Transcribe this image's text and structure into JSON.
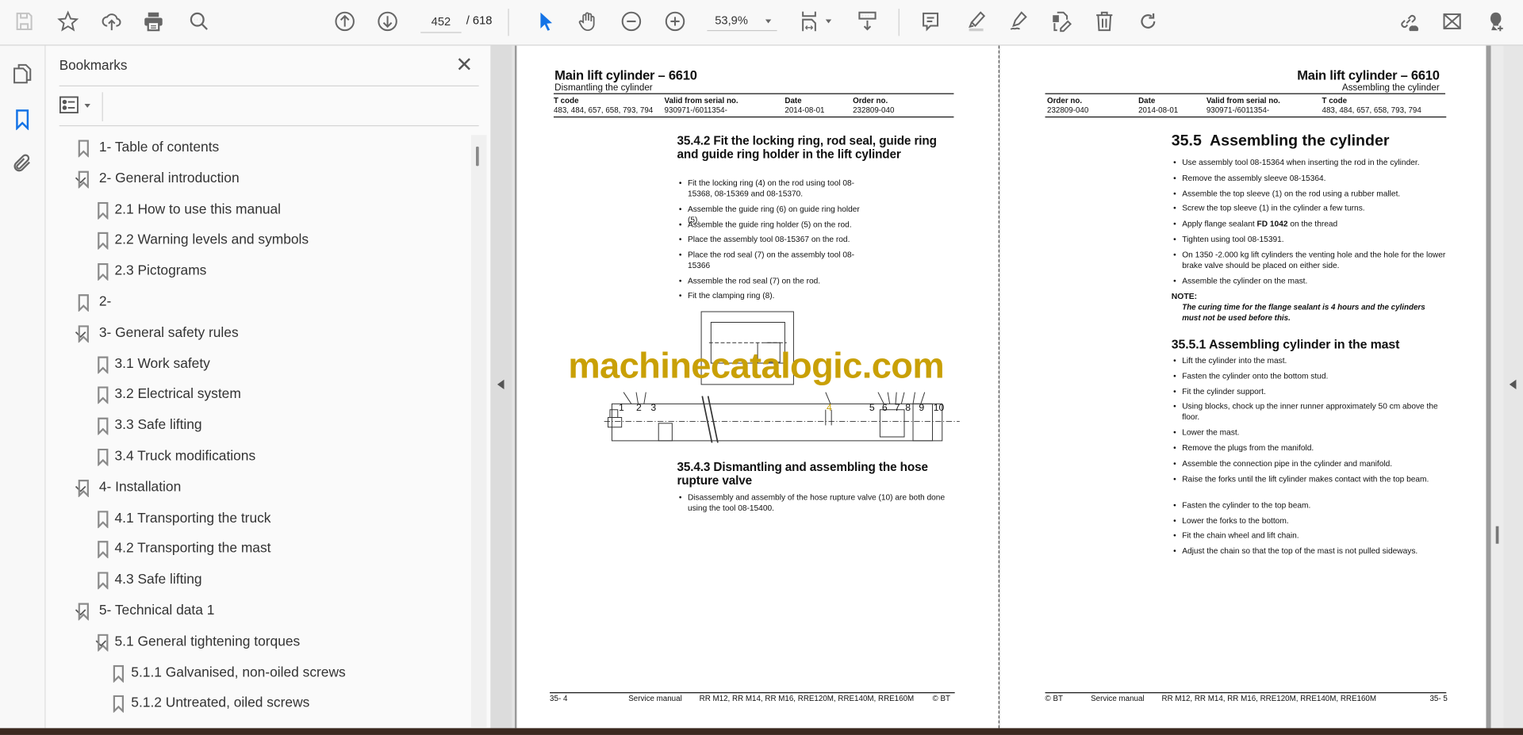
{
  "toolbar": {
    "page_current": "452",
    "page_total": "/ 618",
    "zoom": "53,9%"
  },
  "panel": {
    "title": "Bookmarks"
  },
  "bookmarks": [
    {
      "label": "1- Table of contents",
      "level": 0,
      "expandable": false
    },
    {
      "label": "2- General introduction",
      "level": 0,
      "expandable": true
    },
    {
      "label": "2.1 How to use this manual",
      "level": 1,
      "expandable": false
    },
    {
      "label": "2.2 Warning levels and symbols",
      "level": 1,
      "expandable": false
    },
    {
      "label": "2.3 Pictograms",
      "level": 1,
      "expandable": false
    },
    {
      "label": "2-",
      "level": 0,
      "expandable": false
    },
    {
      "label": "3- General safety rules",
      "level": 0,
      "expandable": true
    },
    {
      "label": "3.1 Work safety",
      "level": 1,
      "expandable": false
    },
    {
      "label": "3.2 Electrical system",
      "level": 1,
      "expandable": false
    },
    {
      "label": "3.3 Safe lifting",
      "level": 1,
      "expandable": false
    },
    {
      "label": "3.4 Truck modifications",
      "level": 1,
      "expandable": false
    },
    {
      "label": "4- Installation",
      "level": 0,
      "expandable": true
    },
    {
      "label": "4.1 Transporting the truck",
      "level": 1,
      "expandable": false
    },
    {
      "label": "4.2 Transporting the mast",
      "level": 1,
      "expandable": false
    },
    {
      "label": "4.3 Safe lifting",
      "level": 1,
      "expandable": false
    },
    {
      "label": "5- Technical data 1",
      "level": 0,
      "expandable": true
    },
    {
      "label": "5.1 General tightening torques",
      "level": 1,
      "expandable": true
    },
    {
      "label": "5.1.1 Galvanised, non-oiled screws",
      "level": 2,
      "expandable": false
    },
    {
      "label": "5.1.2 Untreated, oiled screws",
      "level": 2,
      "expandable": false
    }
  ],
  "left_page": {
    "title": "Main lift cylinder – 6610",
    "subtitle": "Dismantling the cylinder",
    "header_labels": [
      "T code",
      "Valid from serial no.",
      "Date",
      "Order no."
    ],
    "header_values": [
      "483, 484, 657, 658, 793, 794",
      "930971-/6011354-",
      "2014-08-01",
      "232809-040"
    ],
    "section1_heading": "35.4.2 Fit the locking ring, rod seal, guide ring and guide ring holder in the lift cylinder",
    "section1_bullets": [
      "Fit the locking ring (4) on the rod using tool 08-15368, 08-15369 and 08-15370.",
      "Assemble the guide ring (6) on guide ring holder (5).",
      "Assemble the guide ring holder (5) on the rod.",
      "Place the assembly tool 08-15367 on the rod.",
      "Place the rod seal (7) on the assembly tool 08-15366",
      "Assemble the rod seal (7) on the rod.",
      "Fit the clamping ring (8)."
    ],
    "diagram_numbers": [
      "1",
      "2",
      "3",
      "4",
      "5",
      "6",
      "7",
      "8",
      "9",
      "10"
    ],
    "section2_heading": "35.4.3 Dismantling and assembling the hose rupture valve",
    "section2_bullets": [
      "Disassembly and assembly of the hose rupture valve (10) are both done using the tool 08-15400."
    ],
    "footer": {
      "page": "35- 4",
      "doc": "Service manual",
      "models": "RR M12, RR M14, RR M16,  RRE120M, RRE140M, RRE160M",
      "copyright": "© BT"
    }
  },
  "right_page": {
    "title": "Main lift cylinder – 6610",
    "subtitle": "Assembling the cylinder",
    "header_labels": [
      "Order no.",
      "Date",
      "Valid from serial no.",
      "T code"
    ],
    "header_values": [
      "232809-040",
      "2014-08-01",
      "930971-/6011354-",
      "483, 484, 657, 658, 793, 794"
    ],
    "section1_heading": "35.5  Assembling the cylinder",
    "section1_bullets": [
      "Use assembly tool 08-15364 when inserting the rod in the cylinder.",
      "Remove the assembly sleeve 08-15364.",
      "Assemble the top sleeve (1) on the rod using a rubber mallet.",
      "Screw the top sleeve (1) in the cylinder a few turns.",
      "Apply flange sealant FD 1042 on the thread",
      "Tighten using tool 08-15391.",
      "On 1350 -2.000 kg lift cylinders the venting hole and the hole for the lower brake valve should be placed on either side.",
      "Assemble the cylinder on the mast."
    ],
    "note_label": "NOTE:",
    "note_text": "The curing time for the flange sealant is 4 hours and the cylinders must not be used before this.",
    "section2_heading": "35.5.1 Assembling cylinder in the mast",
    "section2_bullets": [
      "Lift the cylinder into the mast.",
      "Fasten the cylinder onto the bottom stud.",
      "Fit the cylinder support.",
      "Using blocks, chock up the inner runner approximately 50 cm above the floor.",
      "Lower the mast.",
      "Remove the plugs from the manifold.",
      "Assemble the connection pipe in the cylinder and manifold.",
      "Raise the forks until the lift cylinder makes contact with the top beam.",
      "Fasten the cylinder to the top beam.",
      "Lower the forks to the bottom.",
      "Fit the chain wheel and lift chain.",
      "Adjust the chain so that the top of the mast is not pulled sideways."
    ],
    "footer": {
      "copyright": "© BT",
      "doc": "Service manual",
      "models": "RR M12, RR M14, RR M16,  RRE120M, RRE140M, RRE160M",
      "page": "35- 5"
    }
  },
  "watermark": "machinecatalogic.com",
  "colors": {
    "accent": "#1473e6",
    "icon": "#6b6b6b",
    "watermark": "#c9a006"
  }
}
